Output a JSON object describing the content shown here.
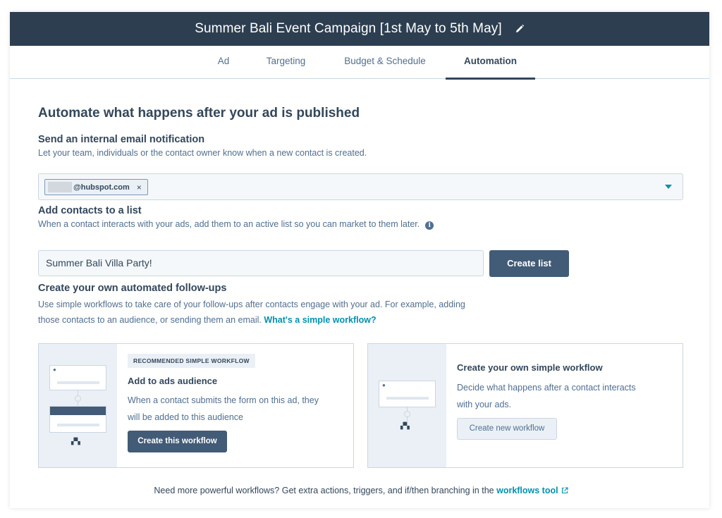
{
  "header": {
    "title": "Summer Bali Event Campaign [1st May to 5th May]"
  },
  "tabs": [
    {
      "label": "Ad",
      "active": false
    },
    {
      "label": "Targeting",
      "active": false
    },
    {
      "label": "Budget & Schedule",
      "active": false
    },
    {
      "label": "Automation",
      "active": true
    }
  ],
  "main": {
    "heading": "Automate what happens after your ad is published",
    "email_section": {
      "title": "Send an internal email notification",
      "description": "Let your team, individuals or the contact owner know when a new contact is created.",
      "chip_text": "@hubspot.com",
      "chip_remove": "×"
    },
    "list_section": {
      "title": "Add contacts to a list",
      "description": "When a contact interacts with your ads, add them to an active list so you can market to them later.",
      "input_value": "Summer Bali Villa Party!",
      "create_button": "Create list"
    },
    "followup_section": {
      "title": "Create your own automated follow-ups",
      "description_line1": "Use simple workflows to take care of your follow-ups after contacts engage with your ad. For example, adding",
      "description_line2": "those contacts to an audience, or sending them an email.",
      "link": "What's a simple workflow?"
    },
    "card_recommended": {
      "badge": "RECOMMENDED SIMPLE WORKFLOW",
      "title": "Add to ads audience",
      "text_line1": "When a contact submits the form on this ad, they",
      "text_line2": "will be added to this audience",
      "button": "Create this workflow"
    },
    "card_custom": {
      "title": "Create your own simple workflow",
      "text_line1": "Decide what happens after a contact interacts",
      "text_line2": "with your ads.",
      "button": "Create new workflow"
    },
    "footer": {
      "text": "Need more powerful workflows? Get extra actions, triggers, and if/then branching in the",
      "link": "workflows tool"
    }
  },
  "colors": {
    "header_bg": "#2d3e50",
    "primary_button": "#425b76",
    "link": "#0091ae",
    "text": "#33475b"
  }
}
